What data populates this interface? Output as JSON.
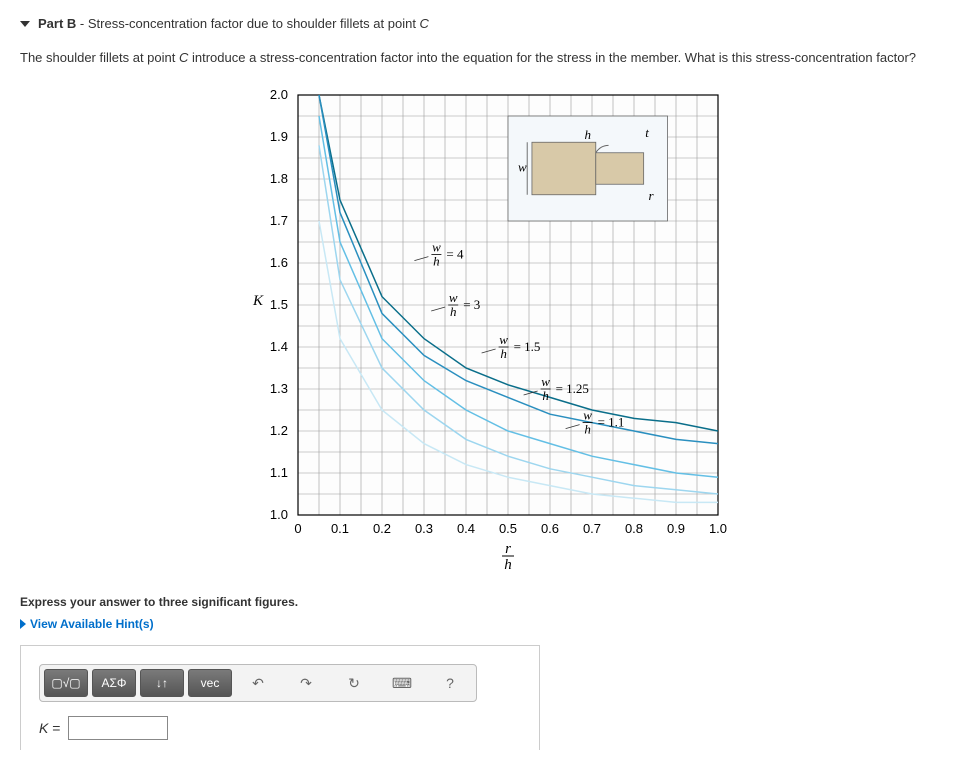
{
  "part": {
    "prefix": "Part B",
    "dash": " - ",
    "title_rest": "Stress-concentration factor due to shoulder fillets at point ",
    "point": "C"
  },
  "question": {
    "line1": "The shoulder fillets at point ",
    "point": "C",
    "line2": " introduce a stress-concentration factor into the equation for the stress in the member. What is this stress-concentration factor?"
  },
  "express": "Express your answer to three significant figures.",
  "hints_label": "View Available Hint(s)",
  "toolbar": {
    "templates": "▢√▢",
    "greek": "ΑΣΦ",
    "arrows": "↓↑",
    "vec": "vec",
    "undo": "↶",
    "redo": "↷",
    "reset": "↻",
    "keyboard": "⌨",
    "help": "?"
  },
  "answer": {
    "label": "K",
    "eq": " = ",
    "value": ""
  },
  "chart_data": {
    "type": "line",
    "xlabel": "r/h",
    "ylabel": "K",
    "xlim": [
      0,
      1.0
    ],
    "ylim": [
      1.0,
      2.0
    ],
    "x_ticks": [
      "0",
      "0.1",
      "0.2",
      "0.3",
      "0.4",
      "0.5",
      "0.6",
      "0.7",
      "0.8",
      "0.9",
      "1.0"
    ],
    "y_ticks": [
      "1.0",
      "1.1",
      "1.2",
      "1.3",
      "1.4",
      "1.5",
      "1.6",
      "1.7",
      "1.8",
      "1.9",
      "2.0"
    ],
    "series": [
      {
        "name": "w/h = 4",
        "color": "#0a6e8a",
        "values": [
          [
            0.05,
            2.0
          ],
          [
            0.1,
            1.75
          ],
          [
            0.2,
            1.52
          ],
          [
            0.3,
            1.42
          ],
          [
            0.4,
            1.35
          ],
          [
            0.5,
            1.31
          ],
          [
            0.6,
            1.28
          ],
          [
            0.7,
            1.25
          ],
          [
            0.8,
            1.23
          ],
          [
            0.9,
            1.22
          ],
          [
            1.0,
            1.2
          ]
        ]
      },
      {
        "name": "w/h = 3",
        "color": "#2a8fbf",
        "values": [
          [
            0.05,
            2.0
          ],
          [
            0.1,
            1.72
          ],
          [
            0.2,
            1.48
          ],
          [
            0.3,
            1.38
          ],
          [
            0.4,
            1.32
          ],
          [
            0.5,
            1.28
          ],
          [
            0.6,
            1.24
          ],
          [
            0.7,
            1.22
          ],
          [
            0.8,
            1.2
          ],
          [
            0.9,
            1.18
          ],
          [
            1.0,
            1.17
          ]
        ]
      },
      {
        "name": "w/h = 1.5",
        "color": "#63bfe5",
        "values": [
          [
            0.05,
            1.95
          ],
          [
            0.1,
            1.65
          ],
          [
            0.2,
            1.42
          ],
          [
            0.3,
            1.32
          ],
          [
            0.4,
            1.25
          ],
          [
            0.5,
            1.2
          ],
          [
            0.6,
            1.17
          ],
          [
            0.7,
            1.14
          ],
          [
            0.8,
            1.12
          ],
          [
            0.9,
            1.1
          ],
          [
            1.0,
            1.09
          ]
        ]
      },
      {
        "name": "w/h = 1.25",
        "color": "#9dd6ef",
        "values": [
          [
            0.05,
            1.88
          ],
          [
            0.1,
            1.56
          ],
          [
            0.2,
            1.35
          ],
          [
            0.3,
            1.25
          ],
          [
            0.4,
            1.18
          ],
          [
            0.5,
            1.14
          ],
          [
            0.6,
            1.11
          ],
          [
            0.7,
            1.09
          ],
          [
            0.8,
            1.07
          ],
          [
            0.9,
            1.06
          ],
          [
            1.0,
            1.05
          ]
        ]
      },
      {
        "name": "w/h = 1.1",
        "color": "#c8e8f5",
        "values": [
          [
            0.05,
            1.7
          ],
          [
            0.1,
            1.42
          ],
          [
            0.2,
            1.25
          ],
          [
            0.3,
            1.17
          ],
          [
            0.4,
            1.12
          ],
          [
            0.5,
            1.09
          ],
          [
            0.6,
            1.07
          ],
          [
            0.7,
            1.05
          ],
          [
            0.8,
            1.04
          ],
          [
            0.9,
            1.03
          ],
          [
            1.0,
            1.03
          ]
        ]
      }
    ],
    "curve_labels": [
      {
        "text_frac": "w",
        "denom": "h",
        "value": "= 4",
        "pos": [
          0.32,
          1.62
        ]
      },
      {
        "text_frac": "w",
        "denom": "h",
        "value": "= 3",
        "pos": [
          0.36,
          1.5
        ]
      },
      {
        "text_frac": "w",
        "denom": "h",
        "value": "= 1.5",
        "pos": [
          0.48,
          1.4
        ]
      },
      {
        "text_frac": "w",
        "denom": "h",
        "value": "= 1.25",
        "pos": [
          0.58,
          1.3
        ]
      },
      {
        "text_frac": "w",
        "denom": "h",
        "value": "= 1.1",
        "pos": [
          0.68,
          1.22
        ]
      }
    ],
    "inset": {
      "w": "w",
      "h": "h",
      "r": "r",
      "t": "t"
    }
  }
}
